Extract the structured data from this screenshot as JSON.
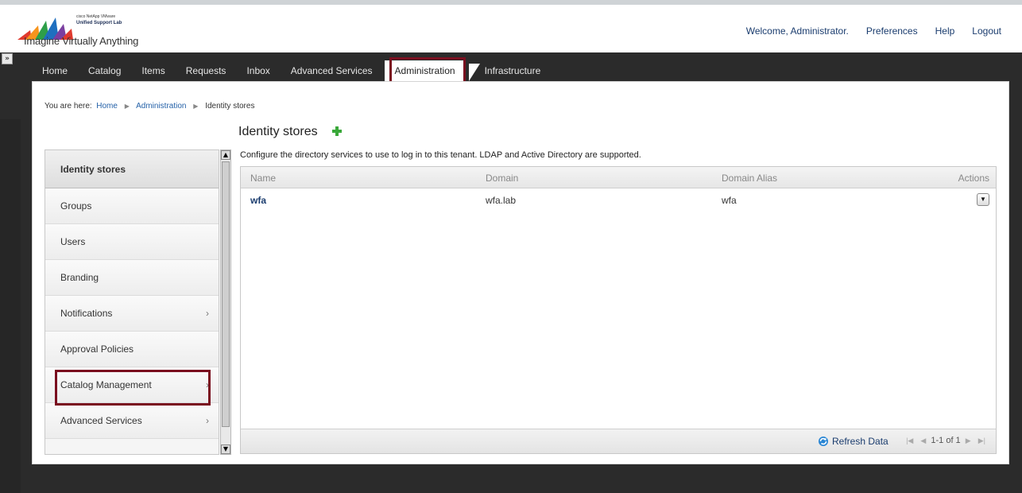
{
  "header": {
    "logo_tagline": "Imagine Virtually Anything",
    "logo_brand_small": "cisco  NetApp  VMware",
    "logo_lab": "Unified Support Lab",
    "welcome": "Welcome, Administrator.",
    "preferences": "Preferences",
    "help": "Help",
    "logout": "Logout"
  },
  "nav": {
    "expander": "»",
    "items": [
      {
        "label": "Home"
      },
      {
        "label": "Catalog"
      },
      {
        "label": "Items"
      },
      {
        "label": "Requests"
      },
      {
        "label": "Inbox"
      },
      {
        "label": "Advanced Services"
      },
      {
        "label": "Administration"
      },
      {
        "label": "Infrastructure"
      }
    ],
    "active": "Administration"
  },
  "breadcrumb": {
    "prefix": "You are here:",
    "items": [
      "Home",
      "Administration",
      "Identity stores"
    ]
  },
  "page": {
    "title": "Identity stores",
    "description": "Configure the directory services to use to log in to this tenant. LDAP and Active Directory are supported."
  },
  "sidebar": {
    "items": [
      {
        "label": "Identity stores",
        "selected": true
      },
      {
        "label": "Groups"
      },
      {
        "label": "Users"
      },
      {
        "label": "Branding"
      },
      {
        "label": "Notifications",
        "chevron": "›"
      },
      {
        "label": "Approval Policies"
      },
      {
        "label": "Catalog Management",
        "chevron": "›"
      },
      {
        "label": "Advanced Services",
        "chevron": "›"
      }
    ]
  },
  "table": {
    "columns": [
      "Name",
      "Domain",
      "Domain Alias",
      "Actions"
    ],
    "rows": [
      {
        "name": "wfa",
        "domain": "wfa.lab",
        "alias": "wfa"
      }
    ],
    "refresh": "Refresh Data",
    "pager": "1-1 of 1"
  },
  "colors": {
    "highlight": "#7a0f1f",
    "nav_bg": "#2b2b2b",
    "link": "#2461a8"
  }
}
